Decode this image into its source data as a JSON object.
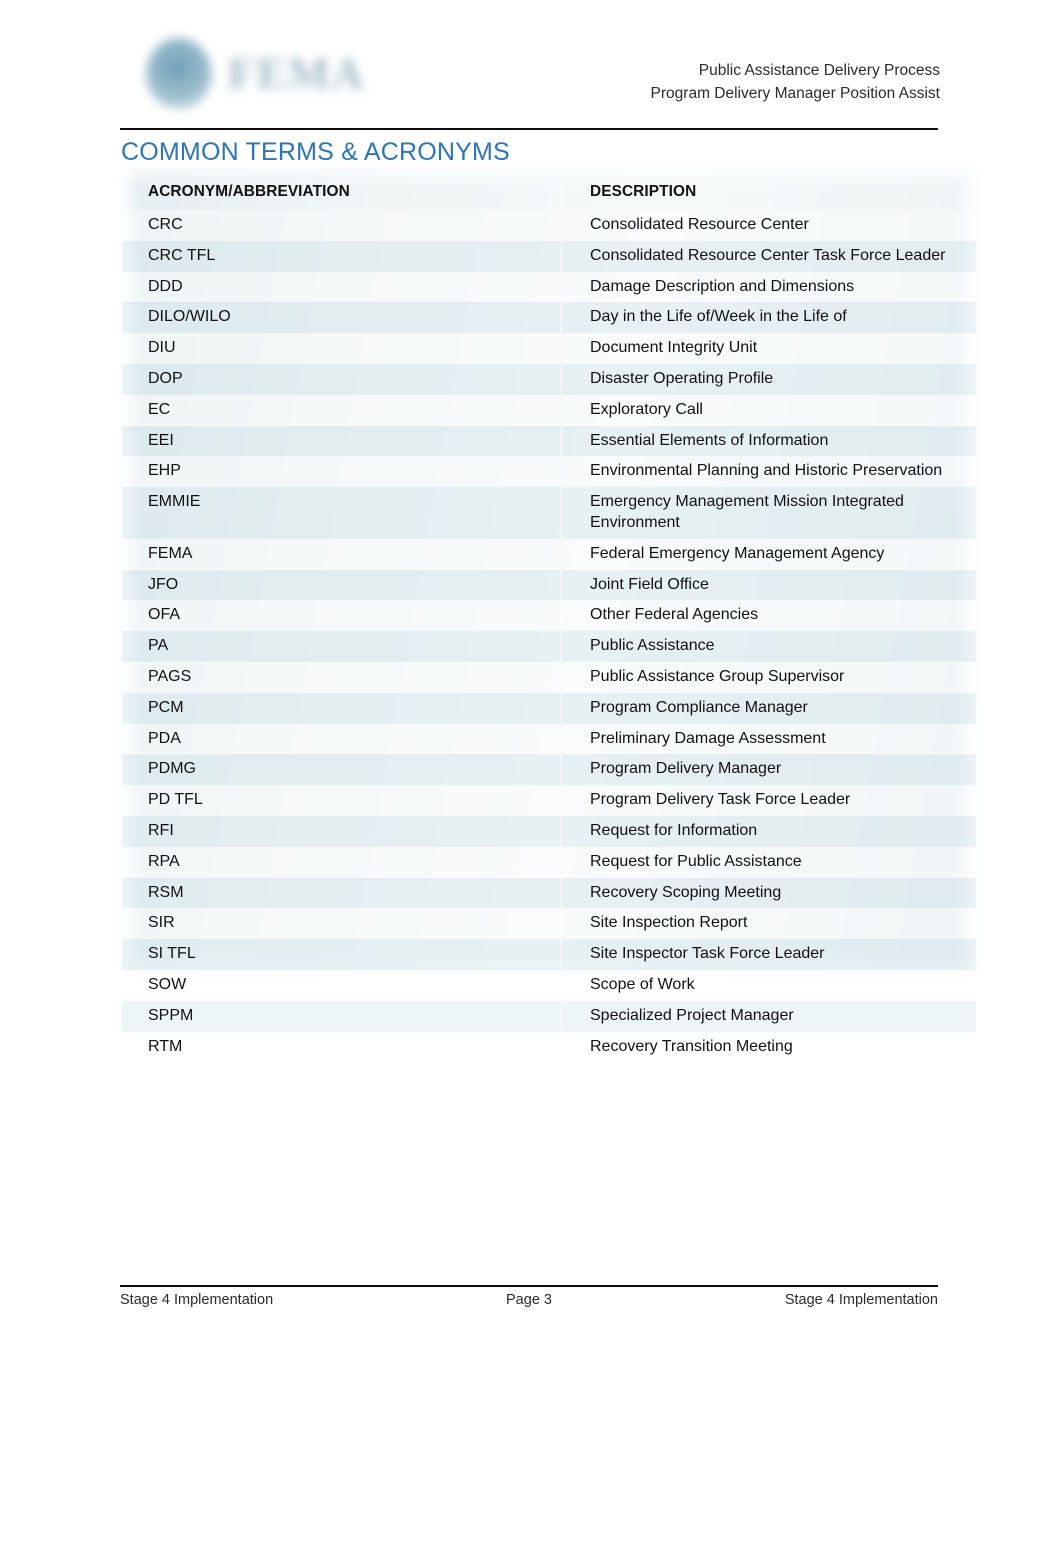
{
  "document": {
    "header": {
      "logo_name": "FEMA",
      "title_line_1": "Public Assistance Delivery Process",
      "title_line_2": "Program Delivery Manager Position Assist"
    },
    "section_title": "COMMON TERMS & ACRONYMS",
    "accent_color": "#2e74b5",
    "table": {
      "columns": [
        "ACRONYM/ABBREVIATION",
        "DESCRIPTION"
      ],
      "rows": [
        {
          "acronym": "CRC",
          "description": "Consolidated Resource Center"
        },
        {
          "acronym": "CRC TFL",
          "description": "Consolidated Resource Center Task Force Leader"
        },
        {
          "acronym": "DDD",
          "description": "Damage Description and Dimensions"
        },
        {
          "acronym": "DILO/WILO",
          "description": "Day in the Life of/Week in the Life of"
        },
        {
          "acronym": "DIU",
          "description": "Document Integrity Unit"
        },
        {
          "acronym": "DOP",
          "description": "Disaster Operating Profile"
        },
        {
          "acronym": "EC",
          "description": "Exploratory Call"
        },
        {
          "acronym": "EEI",
          "description": "Essential Elements of Information"
        },
        {
          "acronym": "EHP",
          "description": "Environmental Planning and Historic Preservation"
        },
        {
          "acronym": "EMMIE",
          "description": "Emergency Management Mission Integrated Environment"
        },
        {
          "acronym": "FEMA",
          "description": "Federal Emergency Management Agency"
        },
        {
          "acronym": "JFO",
          "description": "Joint Field Office"
        },
        {
          "acronym": "OFA",
          "description": "Other Federal Agencies"
        },
        {
          "acronym": "PA",
          "description": "Public Assistance"
        },
        {
          "acronym": "PAGS",
          "description": "Public Assistance Group Supervisor"
        },
        {
          "acronym": "PCM",
          "description": "Program Compliance Manager"
        },
        {
          "acronym": "PDA",
          "description": "Preliminary Damage Assessment"
        },
        {
          "acronym": "PDMG",
          "description": "Program Delivery Manager"
        },
        {
          "acronym": "PD TFL",
          "description": "Program Delivery Task Force Leader"
        },
        {
          "acronym": "RFI",
          "description": "Request for Information"
        },
        {
          "acronym": "RPA",
          "description": "Request for Public Assistance"
        },
        {
          "acronym": "RSM",
          "description": "Recovery Scoping Meeting"
        },
        {
          "acronym": "SIR",
          "description": "Site Inspection Report"
        },
        {
          "acronym": "SI TFL",
          "description": "Site Inspector Task Force Leader"
        },
        {
          "acronym": "SOW",
          "description": "Scope of Work"
        },
        {
          "acronym": "SPPM",
          "description": "Specialized Project Manager"
        },
        {
          "acronym": "RTM",
          "description": "Recovery Transition Meeting"
        }
      ]
    },
    "footer": {
      "left": "Stage 4 Implementation",
      "center": "Page 3",
      "right": "Stage 4 Implementation"
    }
  }
}
